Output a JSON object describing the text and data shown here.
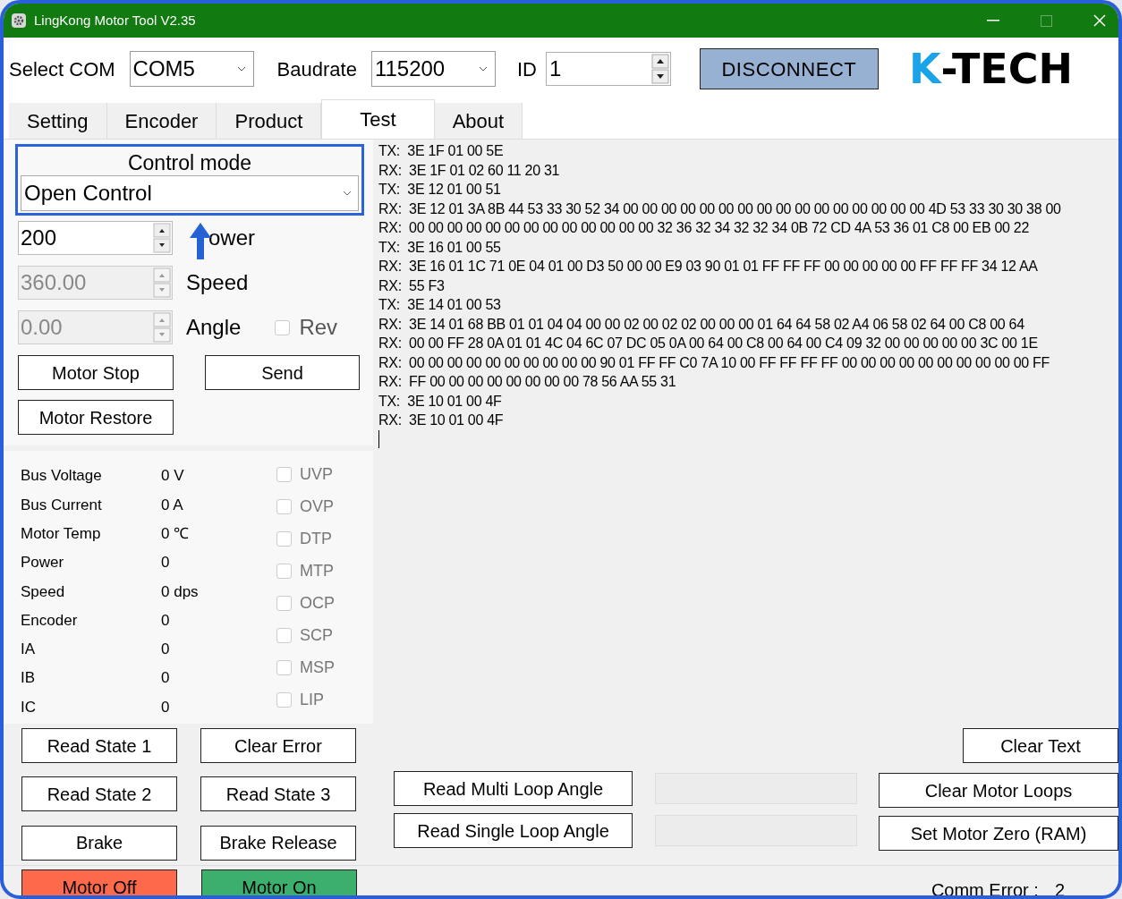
{
  "window": {
    "title": "LingKong Motor Tool V2.35"
  },
  "connection": {
    "com_label": "Select COM",
    "com_value": "COM5",
    "baud_label": "Baudrate",
    "baud_value": "115200",
    "id_label": "ID",
    "id_value": "1",
    "connect_button": "DISCONNECT"
  },
  "logo": {
    "accent": "K",
    "rest": "-TECH"
  },
  "tabs": [
    {
      "label": "Setting",
      "selected": false
    },
    {
      "label": "Encoder",
      "selected": false
    },
    {
      "label": "Product",
      "selected": false
    },
    {
      "label": "Test",
      "selected": true
    },
    {
      "label": "About",
      "selected": false
    }
  ],
  "control_mode": {
    "label": "Control mode",
    "value": "Open Control",
    "highlighted": true
  },
  "setpoints": [
    {
      "value": "200",
      "label": "ower",
      "disabled": false
    },
    {
      "value": "360.00",
      "label": "Speed",
      "disabled": true
    },
    {
      "value": "0.00",
      "label": "Angle",
      "disabled": true
    }
  ],
  "rev": {
    "label": "Rev",
    "checked": false
  },
  "motor_buttons": [
    "Motor Stop",
    "Send",
    "Motor Restore"
  ],
  "readings": [
    {
      "label": "Bus Voltage",
      "value": "0 V"
    },
    {
      "label": "Bus Current",
      "value": "0 A"
    },
    {
      "label": "Motor Temp",
      "value": "0 ℃"
    },
    {
      "label": "Power",
      "value": "0"
    },
    {
      "label": "Speed",
      "value": "0 dps"
    },
    {
      "label": "Encoder",
      "value": "0"
    },
    {
      "label": "IA",
      "value": "0"
    },
    {
      "label": "IB",
      "value": "0"
    },
    {
      "label": "IC",
      "value": "0"
    }
  ],
  "flags": [
    {
      "label": "UVP",
      "checked": false
    },
    {
      "label": "OVP",
      "checked": false
    },
    {
      "label": "DTP",
      "checked": false
    },
    {
      "label": "MTP",
      "checked": false
    },
    {
      "label": "OCP",
      "checked": false
    },
    {
      "label": "SCP",
      "checked": false
    },
    {
      "label": "MSP",
      "checked": false
    },
    {
      "label": "LIP",
      "checked": false
    }
  ],
  "log": [
    "TX:  3E 1F 01 00 5E",
    "RX:  3E 1F 01 02 60 11 20 31",
    "TX:  3E 12 01 00 51",
    "RX:  3E 12 01 3A 8B 44 53 33 30 52 34 00 00 00 00 00 00 00 00 00 00 00 00 00 00 00 00 4D 53 33 30 30 38 00",
    "RX:  00 00 00 00 00 00 00 00 00 00 00 00 00 32 36 32 34 32 32 34 0B 72 CD 4A 53 36 01 C8 00 EB 00 22",
    "TX:  3E 16 01 00 55",
    "RX:  3E 16 01 1C 71 0E 04 01 00 D3 50 00 00 E9 03 90 01 01 FF FF FF 00 00 00 00 00 FF FF FF 34 12 AA",
    "RX:  55 F3",
    "TX:  3E 14 01 00 53",
    "RX:  3E 14 01 68 BB 01 01 04 04 00 00 02 00 02 02 00 00 00 01 64 64 58 02 A4 06 58 02 64 00 C8 00 64",
    "RX:  00 00 FF 28 0A 01 01 4C 04 6C 07 DC 05 0A 00 64 00 C8 00 64 00 C4 09 32 00 00 00 00 00 3C 00 1E",
    "RX:  00 00 00 00 00 00 00 00 00 00 90 01 FF FF C0 7A 10 00 FF FF FF FF 00 00 00 00 00 00 00 00 00 00 FF",
    "RX:  FF 00 00 00 00 00 00 00 00 78 56 AA 55 31",
    "TX:  3E 10 01 00 4F",
    "RX:  3E 10 01 00 4F"
  ],
  "state_buttons": [
    "Read State 1",
    "Clear Error",
    "Read State 2",
    "Read State 3",
    "Brake",
    "Brake Release"
  ],
  "angle_buttons": [
    "Read Multi Loop Angle",
    "Read Single Loop Angle"
  ],
  "right_buttons": [
    "Clear Text",
    "Clear Motor Loops",
    "Set Motor Zero (RAM)"
  ],
  "status_bar": {
    "motor_off": "Motor Off",
    "motor_on": "Motor On",
    "comm_error_label": "Comm Error :",
    "comm_error_value": "2"
  }
}
